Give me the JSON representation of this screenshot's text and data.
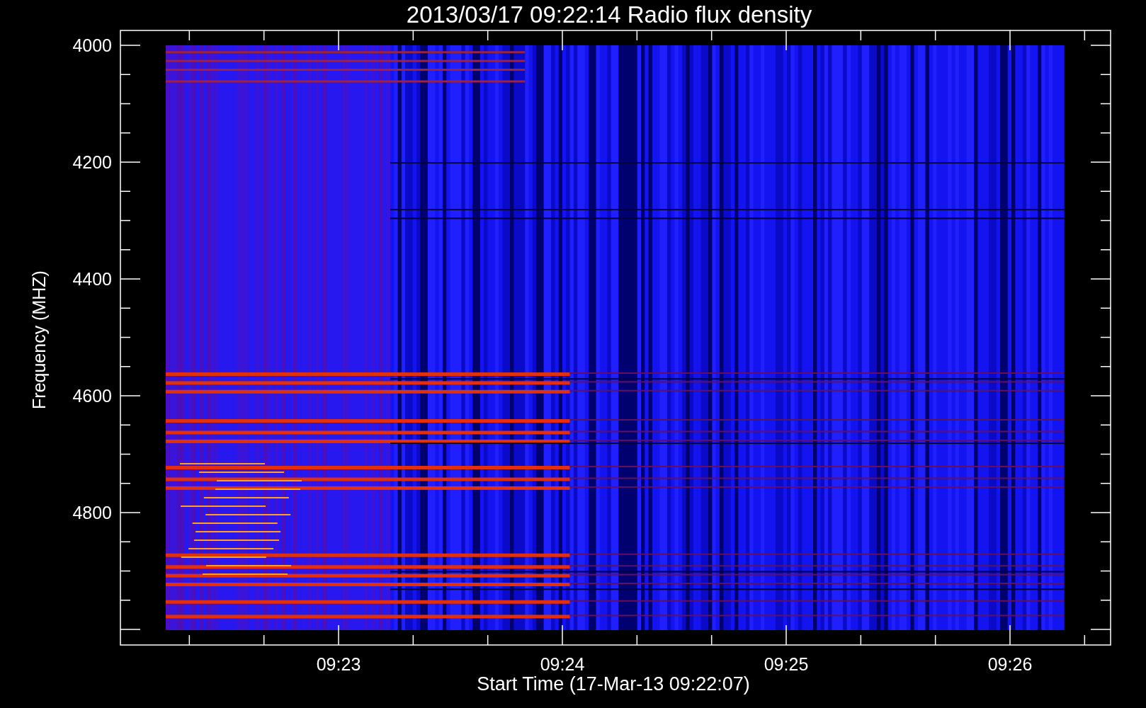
{
  "title": "2013/03/17 09:22:14 Radio flux density",
  "ylabel": "Frequency (MHZ)",
  "xlabel": "Start Time (17-Mar-13 09:22:07)",
  "y_ticks": [
    "4000",
    "4200",
    "4400",
    "4600",
    "4800"
  ],
  "x_ticks": [
    "09:23",
    "09:24",
    "09:25",
    "09:26"
  ]
}
